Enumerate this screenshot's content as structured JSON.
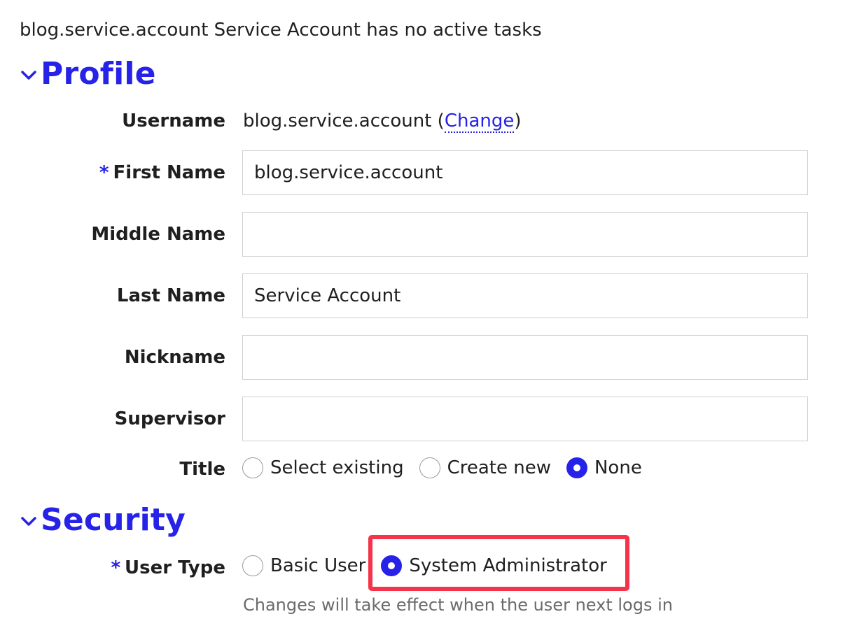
{
  "status_message": "blog.service.account Service Account has no active tasks",
  "profile": {
    "header": "Profile",
    "username_label": "Username",
    "username_value": "blog.service.account",
    "paren_open": "(",
    "change_link": "Change",
    "paren_close": ")",
    "required_marker": "*",
    "first_name_label": "First Name",
    "first_name_value": "blog.service.account",
    "middle_name_label": "Middle Name",
    "middle_name_value": "",
    "last_name_label": "Last Name",
    "last_name_value": "Service Account",
    "nickname_label": "Nickname",
    "nickname_value": "",
    "supervisor_label": "Supervisor",
    "supervisor_value": "",
    "title_label": "Title",
    "title_options": [
      {
        "label": "Select existing",
        "selected": false
      },
      {
        "label": "Create new",
        "selected": false
      },
      {
        "label": "None",
        "selected": true
      }
    ]
  },
  "security": {
    "header": "Security",
    "required_marker": "*",
    "user_type_label": "User Type",
    "user_type_options": [
      {
        "label": "Basic User",
        "selected": false
      },
      {
        "label": "System Administrator",
        "selected": true
      }
    ],
    "help_text": "Changes will take effect when the user next logs in"
  },
  "colors": {
    "accent": "#2622e8",
    "highlight": "#f5334a",
    "muted_text": "#6b6b6b"
  },
  "icons": {
    "section_toggle": "chevron-down-icon"
  }
}
